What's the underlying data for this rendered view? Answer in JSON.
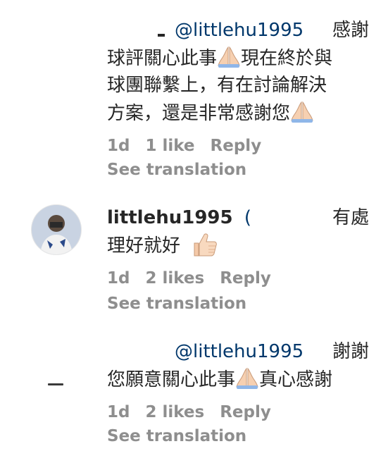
{
  "comments": [
    {
      "mention": "@littlehu1995",
      "lines": [
        "感謝",
        "球評關心此事",
        "現在終於與",
        "球團聯繫上，有在討論解決",
        "方案，還是非常感謝您"
      ],
      "meta": {
        "time": "1d",
        "likes": "1 like",
        "reply": "Reply"
      },
      "see_translation": "See translation"
    },
    {
      "username": "littlehu1995",
      "paren": "(",
      "lines": [
        "有處",
        "理好就好"
      ],
      "meta": {
        "time": "1d",
        "likes": "2 likes",
        "reply": "Reply"
      },
      "see_translation": "See translation"
    },
    {
      "mention": "@littlehu1995",
      "lines": [
        "謝謝",
        "您願意關心此事",
        "真心感謝"
      ],
      "meta": {
        "time": "1d",
        "likes": "2 likes",
        "reply": "Reply"
      },
      "see_translation": "See translation"
    }
  ],
  "icons": {
    "pray": "folded-hands-emoji",
    "thumbs": "thumbs-up-emoji"
  }
}
